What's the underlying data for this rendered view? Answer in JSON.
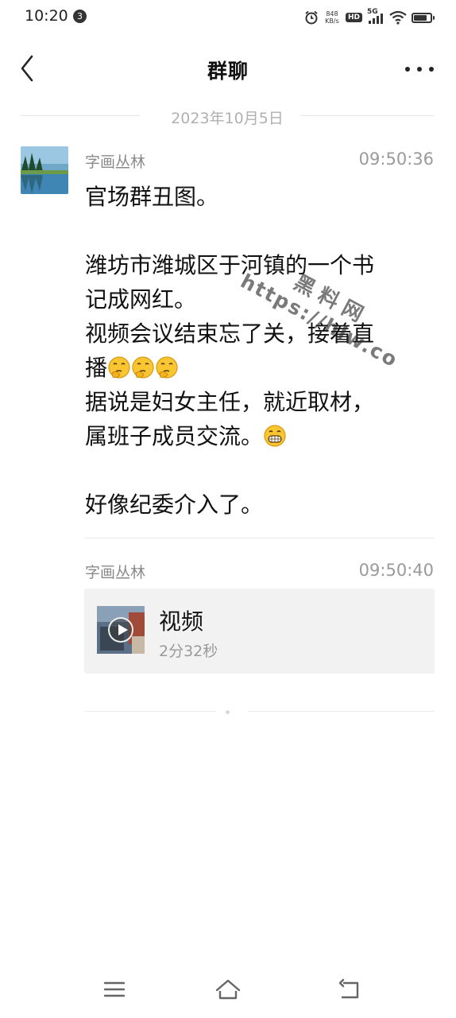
{
  "status_bar": {
    "time": "10:20",
    "notification_count": "3",
    "net_speed_value": "848",
    "net_speed_unit": "KB/s",
    "hd_label": "HD",
    "network_label": "5G",
    "icons": [
      "alarm-icon",
      "wifi-icon",
      "battery-icon",
      "signal-icon"
    ]
  },
  "header": {
    "title": "群聊",
    "back_icon": "chevron-left-icon",
    "more_icon": "more-horizontal-icon"
  },
  "conversation": {
    "date_divider": "2023年10月5日",
    "messages": [
      {
        "sender": "字画丛林",
        "time": "09:50:36",
        "lines": [
          "官场群丑图。",
          "",
          "潍坊市潍城区于河镇的一个书",
          "记成网红。",
          "视频会议结束忘了关，接着直",
          "播",
          "据说是妇女主任，就近取材，",
          "属班子成员交流。",
          "",
          "好像纪委介入了。"
        ],
        "emoji": [
          "thinking-emoji",
          "grinning-emoji"
        ]
      },
      {
        "sender": "字画丛林",
        "time": "09:50:40",
        "video": {
          "title": "视频",
          "duration": "2分32秒",
          "icon": "play-icon"
        }
      }
    ]
  },
  "watermark": {
    "line1": "黑料网",
    "line2": "https://hlw.co"
  },
  "bottom_nav": {
    "icons": [
      "menu-icon",
      "home-icon",
      "back-icon"
    ]
  },
  "colors": {
    "background": "#ffffff",
    "secondary_text": "#9a9a9a",
    "card_background": "#f2f2f2"
  }
}
